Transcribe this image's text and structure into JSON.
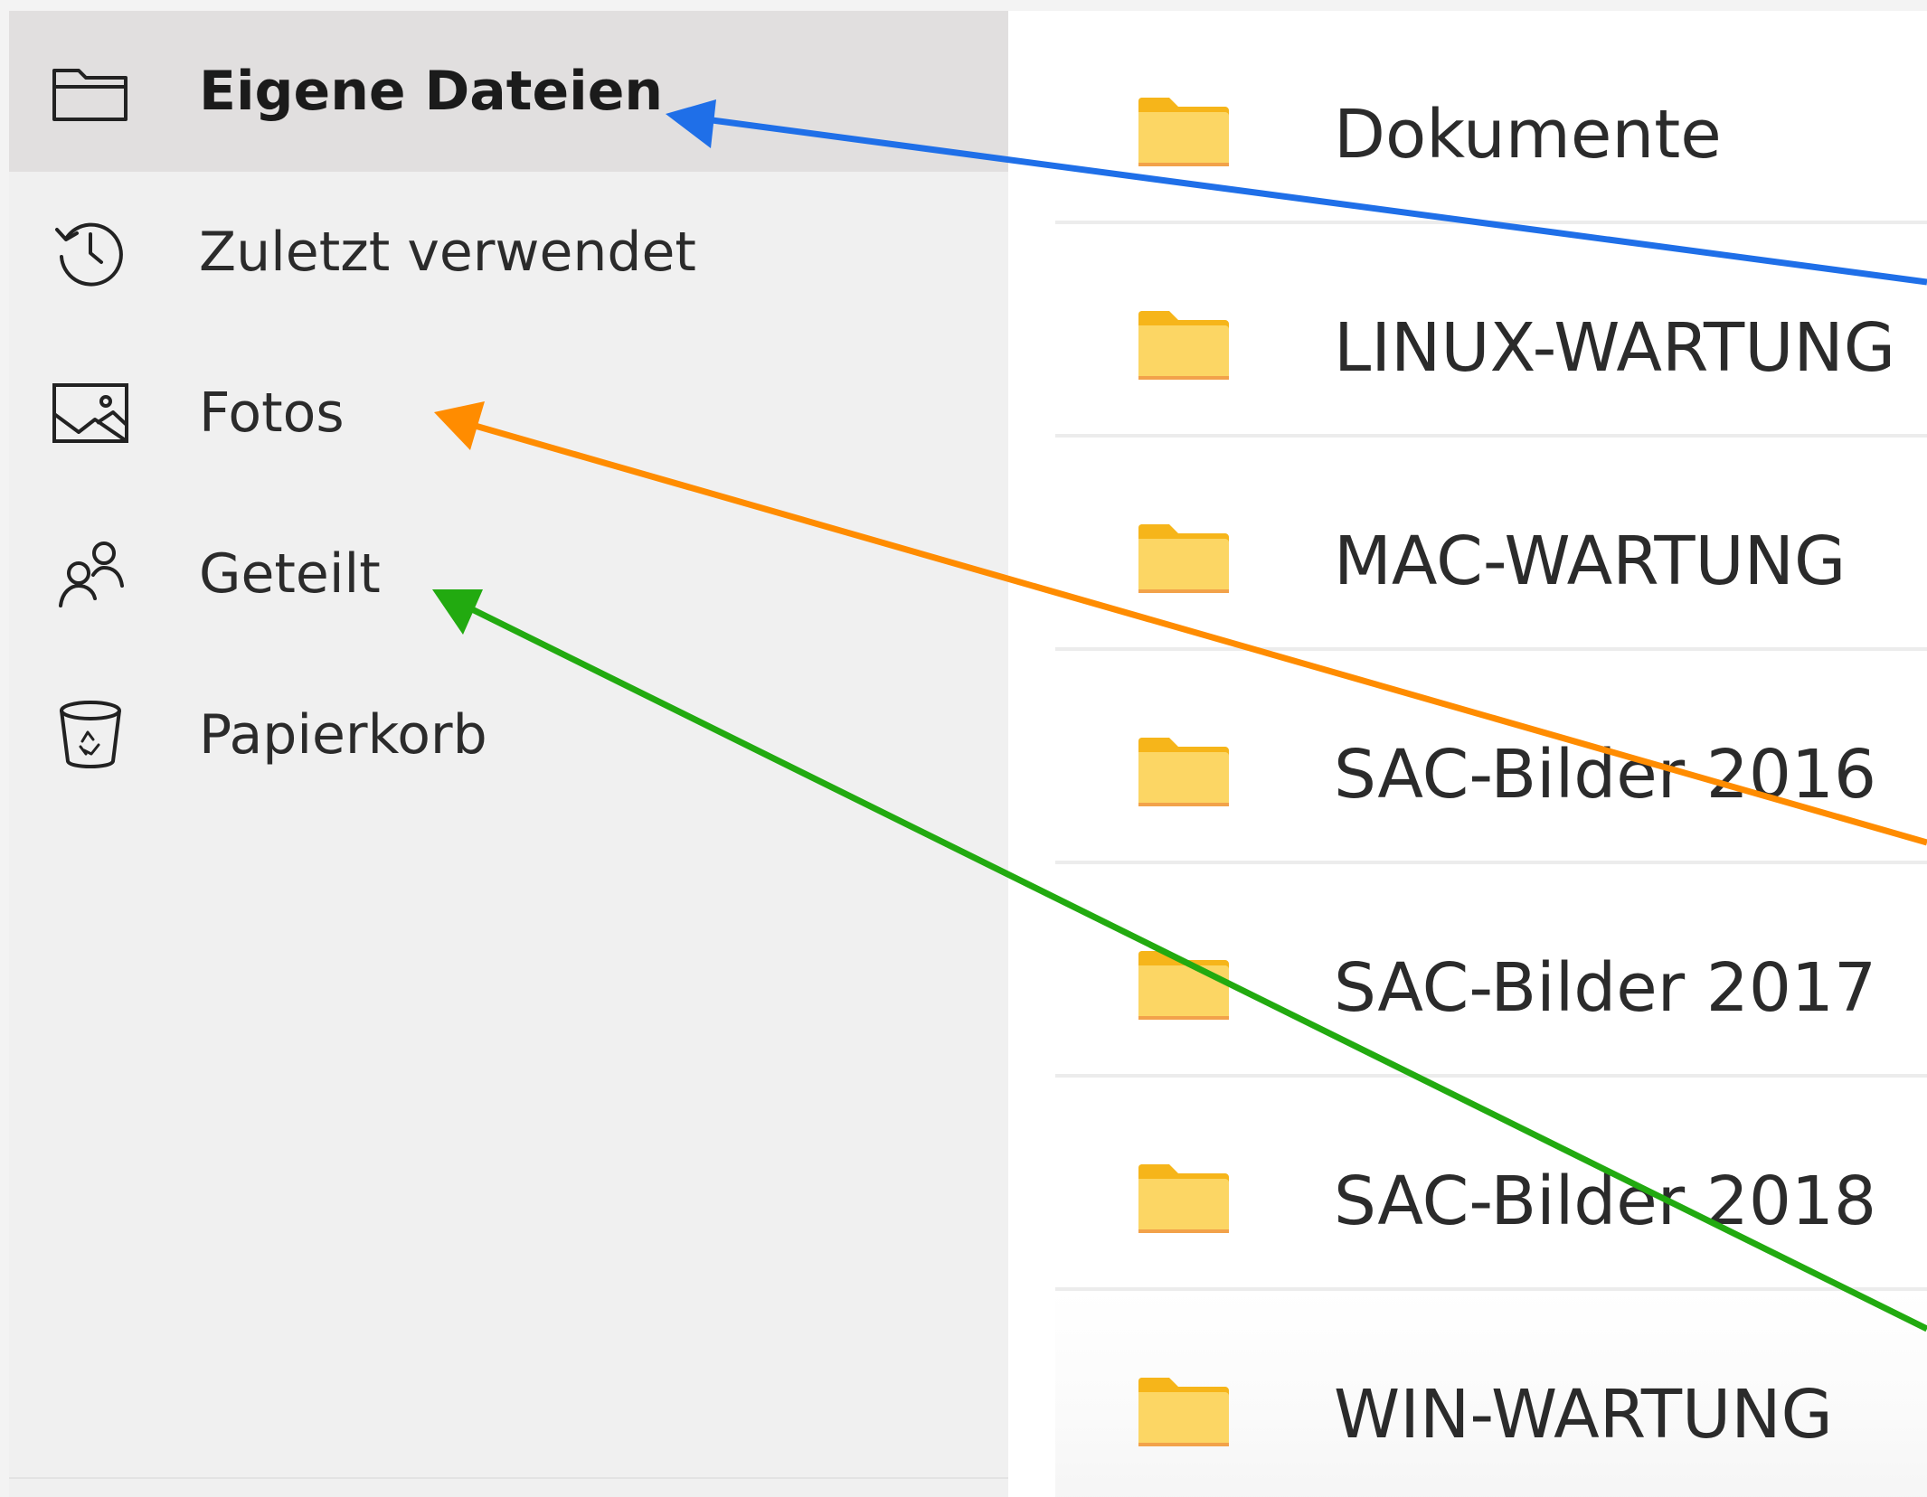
{
  "sidebar": {
    "items": [
      {
        "label": "Eigene Dateien",
        "icon": "folder-outline-icon",
        "selected": true
      },
      {
        "label": "Zuletzt verwendet",
        "icon": "history-icon",
        "selected": false
      },
      {
        "label": "Fotos",
        "icon": "image-icon",
        "selected": false
      },
      {
        "label": "Geteilt",
        "icon": "people-icon",
        "selected": false
      },
      {
        "label": "Papierkorb",
        "icon": "recycle-bin-icon",
        "selected": false
      }
    ]
  },
  "files": [
    {
      "name": "Dokumente",
      "icon": "folder-icon"
    },
    {
      "name": "LINUX-WARTUNG",
      "icon": "folder-icon"
    },
    {
      "name": "MAC-WARTUNG",
      "icon": "folder-icon"
    },
    {
      "name": "SAC-Bilder 2016",
      "icon": "folder-icon"
    },
    {
      "name": "SAC-Bilder 2017",
      "icon": "folder-icon"
    },
    {
      "name": "SAC-Bilder 2018",
      "icon": "folder-icon"
    },
    {
      "name": "WIN-WARTUNG",
      "icon": "folder-icon"
    }
  ],
  "annotations": {
    "arrow_colors": {
      "eigene_dateien": "#1f6fe8",
      "fotos": "#ff8c00",
      "geteilt": "#22aa10"
    }
  },
  "colors": {
    "sidebar_bg": "#f0f0f0",
    "selected_bg": "#e1dfdf",
    "folder_yellow": "#fcd664",
    "folder_tab": "#f6b51a"
  }
}
